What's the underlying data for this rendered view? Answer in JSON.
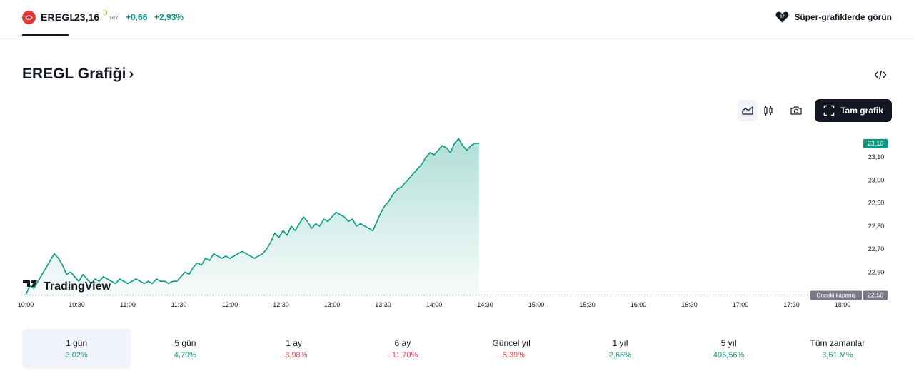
{
  "header": {
    "symbol": "EREGL",
    "price": "23,16",
    "price_marker": "D",
    "currency": "TRY",
    "change": "+0,66",
    "change_pct": "+2,93%",
    "super_charts_label": "Süper-grafiklerde görün",
    "logo_icon": "ereg-logo-icon",
    "super_icon": "heart-badge-icon"
  },
  "title": {
    "text": "EREGL Grafiği",
    "chevron": "›"
  },
  "toolbar": {
    "full_chart_label": "Tam grafik",
    "icons": [
      "area-chart-icon",
      "candles-icon",
      "camera-icon",
      "embed-code-icon",
      "fullscreen-icon"
    ]
  },
  "chart_data": {
    "type": "area",
    "x_ticks": [
      "10:00",
      "10:30",
      "11:00",
      "11:30",
      "12:00",
      "12:30",
      "13:00",
      "13:30",
      "14:00",
      "14:30",
      "15:00",
      "15:30",
      "16:00",
      "16:30",
      "17:00",
      "17:30",
      "18:00"
    ],
    "y_ticks": [
      "23,10",
      "23,00",
      "22,90",
      "22,80",
      "22,70",
      "22,60"
    ],
    "y_tick_values": [
      23.1,
      23.0,
      22.9,
      22.8,
      22.7,
      22.6
    ],
    "ylim": [
      22.48,
      23.2
    ],
    "xlim_minutes": [
      0,
      480
    ],
    "last_price_label": "23,16",
    "previous_close_label": "Önceki kapanış",
    "previous_close_value_label": "22,50",
    "previous_close": 22.5,
    "watermark": "TradingView",
    "line_color": "#089981",
    "series": [
      {
        "x": [
          0,
          1,
          2,
          3,
          4,
          5,
          6,
          7,
          8,
          9,
          10,
          11,
          12,
          13,
          14,
          15,
          16,
          17,
          18,
          19,
          20,
          21,
          22,
          23,
          24,
          25,
          26,
          27,
          28,
          29,
          30,
          31,
          32,
          33,
          34,
          35,
          36,
          37,
          38,
          39,
          40,
          41,
          42,
          43,
          44,
          45,
          46,
          47,
          48,
          49,
          50,
          51,
          52,
          53,
          54,
          55,
          56,
          57,
          58,
          59,
          60,
          61,
          62,
          63,
          64,
          65,
          66,
          67,
          68,
          69,
          70,
          71,
          72,
          73,
          74,
          75,
          76,
          77,
          78,
          79,
          80,
          81,
          82,
          83,
          84,
          85,
          86,
          87,
          88,
          89,
          90,
          91,
          92,
          93,
          94,
          95,
          96,
          97,
          98,
          99,
          100,
          101,
          102,
          103,
          104,
          105,
          106,
          107,
          108,
          109,
          110,
          111
        ],
        "values": [
          22.5,
          22.54,
          22.53,
          22.56,
          22.59,
          22.62,
          22.65,
          22.68,
          22.66,
          22.63,
          22.59,
          22.6,
          22.58,
          22.56,
          22.59,
          22.57,
          22.55,
          22.57,
          22.56,
          22.58,
          22.57,
          22.56,
          22.55,
          22.57,
          22.56,
          22.55,
          22.56,
          22.57,
          22.56,
          22.55,
          22.56,
          22.55,
          22.57,
          22.56,
          22.56,
          22.55,
          22.56,
          22.56,
          22.58,
          22.6,
          22.59,
          22.62,
          22.64,
          22.63,
          22.66,
          22.65,
          22.68,
          22.67,
          22.66,
          22.67,
          22.66,
          22.67,
          22.68,
          22.69,
          22.68,
          22.67,
          22.66,
          22.67,
          22.68,
          22.7,
          22.73,
          22.77,
          22.75,
          22.78,
          22.76,
          22.8,
          22.78,
          22.81,
          22.84,
          22.82,
          22.79,
          22.81,
          22.8,
          22.83,
          22.82,
          22.84,
          22.86,
          22.85,
          22.84,
          22.82,
          22.83,
          22.8,
          22.81,
          22.8,
          22.79,
          22.78,
          22.82,
          22.86,
          22.89,
          22.91,
          22.94,
          22.96,
          22.97,
          22.99,
          23.01,
          23.03,
          23.05,
          23.07,
          23.1,
          23.12,
          23.11,
          23.13,
          23.15,
          23.14,
          23.12,
          23.16,
          23.18,
          23.15,
          23.13,
          23.15,
          23.16,
          23.16
        ]
      }
    ]
  },
  "periods": [
    {
      "label": "1 gün",
      "value": "3,02%",
      "sign": "pos",
      "active": true
    },
    {
      "label": "5 gün",
      "value": "4,79%",
      "sign": "pos",
      "active": false
    },
    {
      "label": "1 ay",
      "value": "−3,98%",
      "sign": "neg",
      "active": false
    },
    {
      "label": "6 ay",
      "value": "−11,70%",
      "sign": "neg",
      "active": false
    },
    {
      "label": "Güncel yıl",
      "value": "−5,39%",
      "sign": "neg",
      "active": false
    },
    {
      "label": "1 yıl",
      "value": "2,66%",
      "sign": "pos",
      "active": false
    },
    {
      "label": "5 yıl",
      "value": "405,56%",
      "sign": "pos",
      "active": false
    },
    {
      "label": "Tüm zamanlar",
      "value": "3,51 M%",
      "sign": "pos",
      "active": false
    }
  ]
}
